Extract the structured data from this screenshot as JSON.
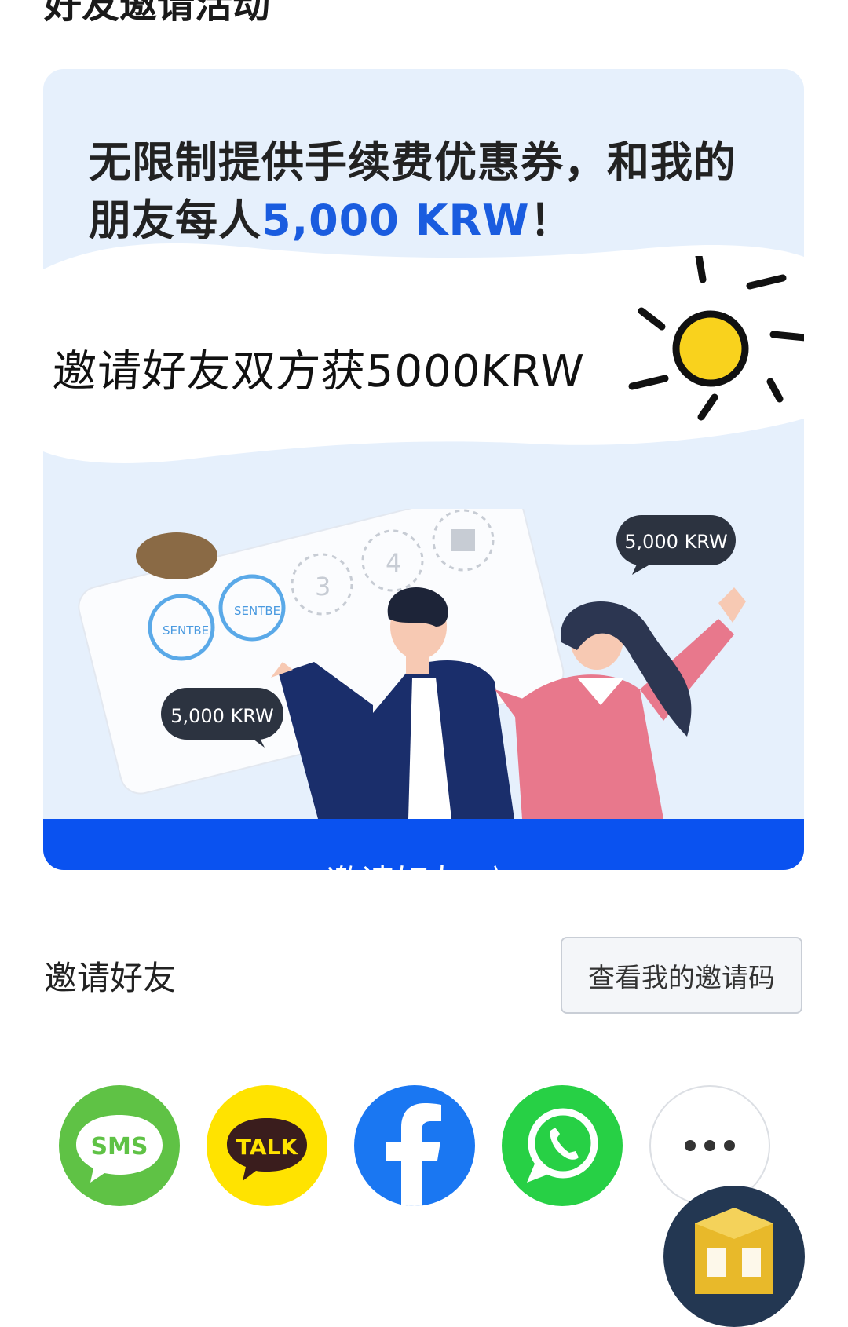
{
  "page": {
    "title": "好友邀请活动"
  },
  "banner": {
    "headline_part1": "无限制提供手续费优惠券，和我的朋友每人",
    "headline_amount": "5,000 KRW",
    "headline_end": "！",
    "handwritten_caption": "邀请好友双方获5000KRW",
    "bubble_top": "5,000 KRW",
    "bubble_left": "5,000 KRW",
    "stamp_label": "SENTBE",
    "stamp_numbers": [
      "3",
      "4"
    ],
    "cta_label": "邀请好友",
    "cta_chevron": "〉"
  },
  "invite_section": {
    "label": "邀请好友",
    "view_code_button": "查看我的邀请码"
  },
  "share_buttons": [
    {
      "name": "sms",
      "label": "SMS",
      "color": "#5fc245"
    },
    {
      "name": "kakaotalk",
      "label": "TALK",
      "color": "#ffe300"
    },
    {
      "name": "facebook",
      "label": "f",
      "color": "#1a77f2"
    },
    {
      "name": "whatsapp",
      "label": "",
      "color": "#27d045"
    },
    {
      "name": "more",
      "label": "",
      "color": "#ffffff"
    }
  ],
  "colors": {
    "accent": "#0a52f0",
    "amount": "#1a5cdf",
    "banner_bg": "#e6f0fc"
  }
}
